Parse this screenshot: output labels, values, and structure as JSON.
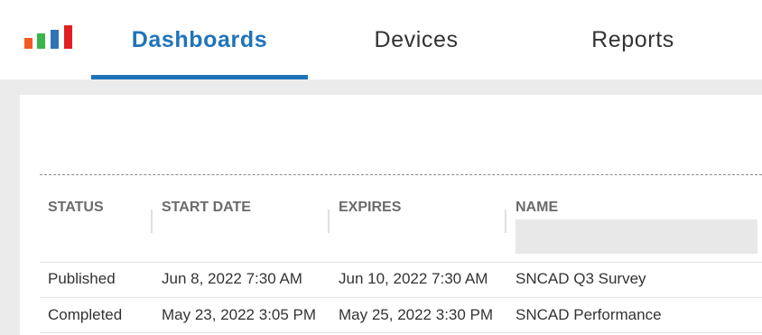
{
  "nav": {
    "tabs": [
      {
        "label": "Dashboards",
        "active": true
      },
      {
        "label": "Devices",
        "active": false
      },
      {
        "label": "Reports",
        "active": false
      }
    ],
    "logo": {
      "icon": "bar-chart-logo-icon",
      "bar_colors": [
        "#f15a24",
        "#39b54a",
        "#2e75b6",
        "#e02020"
      ]
    },
    "accent_color": "#1f74b9"
  },
  "table": {
    "columns": [
      "STATUS",
      "START DATE",
      "EXPIRES",
      "NAME"
    ],
    "rows": [
      {
        "status": "Published",
        "start_date": "Jun 8, 2022 7:30 AM",
        "expires": "Jun 10, 2022 7:30 AM",
        "name": "SNCAD Q3 Survey"
      },
      {
        "status": "Completed",
        "start_date": "May 23, 2022 3:05 PM",
        "expires": "May 25, 2022 3:30 PM",
        "name": "SNCAD Performance"
      }
    ]
  }
}
